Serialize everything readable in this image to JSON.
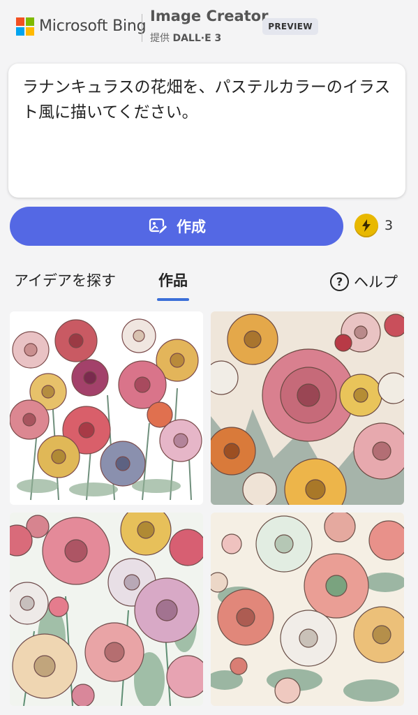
{
  "header": {
    "brand": "Microsoft Bing",
    "product_title": "Image Creator",
    "provided_by_prefix": "提供",
    "provided_by_name": "DALL·E 3",
    "badge": "PREVIEW",
    "logo_colors": [
      "#f25022",
      "#7fba00",
      "#00a4ef",
      "#ffb900"
    ]
  },
  "prompt": {
    "text": "ラナンキュラスの花畑を、パステルカラーのイラスト風に描いてください。"
  },
  "create_button": {
    "label": "作成",
    "icon": "image-pen-icon",
    "color": "#5468e4"
  },
  "boosts": {
    "icon": "lightning-icon",
    "count": "3"
  },
  "tabs": {
    "ideas": "アイデアを探す",
    "works": "作品",
    "active": "works"
  },
  "help": {
    "icon": "question-circle-icon",
    "label": "ヘルプ"
  },
  "results": [
    {
      "name": "ranunculus-image-1",
      "background": "#ffffff"
    },
    {
      "name": "ranunculus-image-2",
      "background": "#efe6da"
    },
    {
      "name": "ranunculus-image-3",
      "background": "#f1f4ef"
    },
    {
      "name": "ranunculus-image-4",
      "background": "#f5efe4"
    }
  ]
}
